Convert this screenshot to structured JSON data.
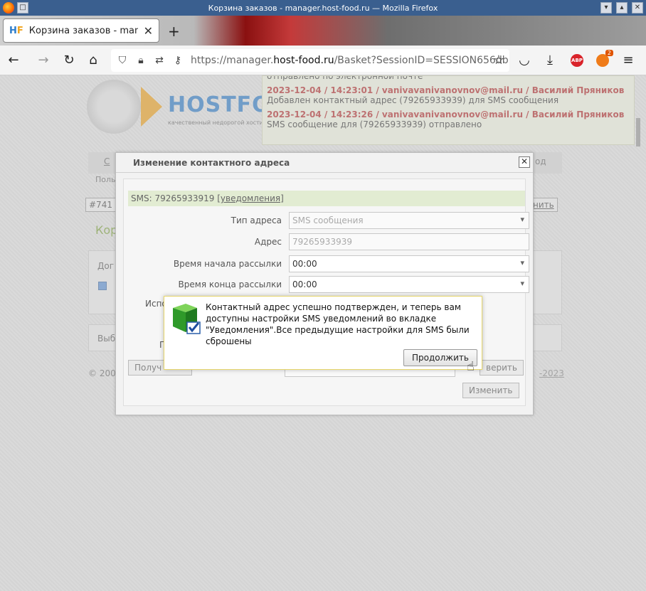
{
  "window": {
    "title": "Корзина заказов - manager.host-food.ru — Mozilla Firefox"
  },
  "tab": {
    "label": "Корзина заказов - manage",
    "favicon_text": "H",
    "favicon_accent": "F"
  },
  "nav": {
    "url_prefix": "https://manager.",
    "url_domain": "host-food.ru",
    "url_rest": "/Basket?SessionID=SESSION656db",
    "ext_abp": "ABP",
    "ext_badge": "2"
  },
  "site": {
    "logo_text": "HOSTFOOD",
    "logo_sub": "качественный недорогой хостинг",
    "bg_nav_left": "С",
    "bg_nav_right": "од",
    "bg_sub": "Поль",
    "bg_box_left": "#741",
    "bg_box_right": "нить",
    "bg_heading": "Кор",
    "bg_panel_text": "Дог",
    "bg_panel2_text": "Выб",
    "bg_use": "Испол",
    "bg_pri": "Пр",
    "footer_left": "© 200",
    "footer_right": "-2023"
  },
  "log": {
    "top_line": "отправлено по электронной почте",
    "entries": [
      {
        "head": "2023-12-04 / 14:23:01 / vanivavanivanovnov@mail.ru / Василий Пряников",
        "text": "Добавлен контактный адрес (79265933939) для SMS сообщения"
      },
      {
        "head": "2023-12-04 / 14:23:26 / vanivavanivanovnov@mail.ru / Василий Пряников",
        "text": "SMS сообщение для (79265933939) отправлено"
      }
    ]
  },
  "dialog": {
    "title": "Изменение контактного адреса",
    "close": "✕",
    "sms_text": "SMS: 79265933919 ",
    "sms_link": "[уведомления]",
    "rows": [
      {
        "label": "Тип адреса",
        "value": "SMS сообщения"
      },
      {
        "label": "Адрес",
        "value": "79265933939"
      },
      {
        "label": "Время начала рассылки",
        "value": "00:00"
      },
      {
        "label": "Время конца рассылки",
        "value": "00:00"
      }
    ],
    "get_button": "Получ",
    "check_button": "верить",
    "change_button": "Изменить"
  },
  "alert": {
    "text": "Контактный адрес успешно подтвержден, и теперь вам доступны настройки SMS уведомлений во вкладке \"Уведомления\".Все предыдущие настройки для SMS были сброшены",
    "button": "Продолжить"
  }
}
